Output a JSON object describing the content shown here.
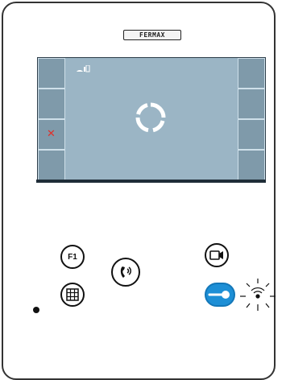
{
  "device": {
    "brand": "FERMAX"
  },
  "screen": {
    "status_icon": "signal-icon",
    "left_buttons": [
      "",
      "",
      "cancel",
      ""
    ],
    "right_buttons": [
      "",
      "",
      "",
      ""
    ],
    "loading": true
  },
  "controls": {
    "f1_label": "F1",
    "menu_icon": "grid-icon",
    "talk_icon": "handset-icon",
    "camera_icon": "camera-icon",
    "door_icon": "key-icon",
    "accent_color": "#1d8fd6"
  }
}
